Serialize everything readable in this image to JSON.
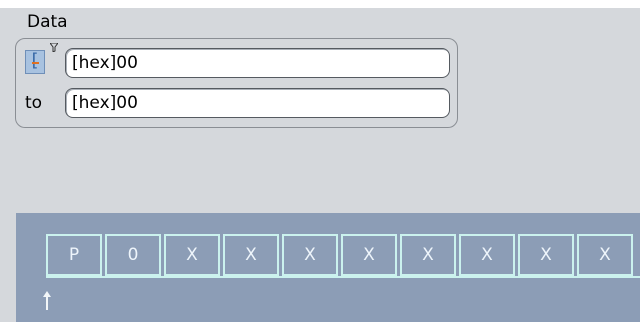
{
  "section": {
    "label": "Data"
  },
  "condition": {
    "operator_icon": "range-operator-icon",
    "min_value": "[hex]00",
    "max_label": "to",
    "max_value": "[hex]00"
  },
  "bit_pattern": {
    "cells": [
      "P",
      "0",
      "X",
      "X",
      "X",
      "X",
      "X",
      "X",
      "X",
      "X"
    ]
  },
  "colors": {
    "background": "#d5d8dc",
    "bit_panel": "#8c9db6",
    "bit_border": "#cbf2ee",
    "operator_button": "#a8c2e0"
  }
}
